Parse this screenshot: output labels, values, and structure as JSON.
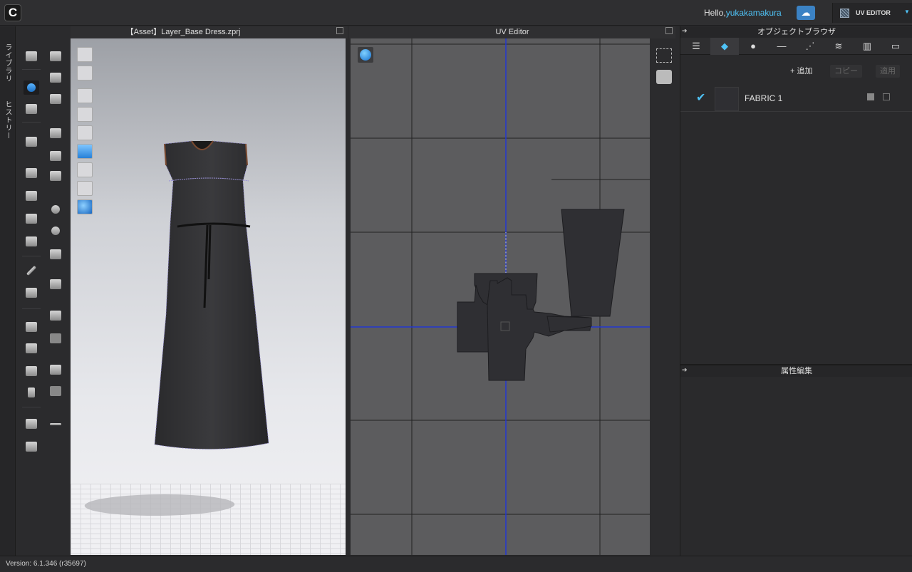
{
  "header": {
    "greeting": "Hello,",
    "username": "yukakamakura",
    "mode_label": "UV EDITOR"
  },
  "side_tabs": [
    "ライブラリ",
    "ヒストリー"
  ],
  "panel3d": {
    "title": "【Asset】Layer_Base Dress.zprj"
  },
  "uv_editor": {
    "title": "UV Editor"
  },
  "object_browser": {
    "title": "オブジェクトブラウザ",
    "add_label": "+ 追加",
    "copy_label": "コピー",
    "apply_label": "適用",
    "fabric_name": "FABRIC 1"
  },
  "property_editor": {
    "title": "属性編集"
  },
  "status": {
    "version": "Version: 6.1.346 (r35697)"
  },
  "colors": {
    "accent": "#4fc3f7",
    "axis": "#1e2fd0",
    "canvas": "#5c5c5e"
  }
}
